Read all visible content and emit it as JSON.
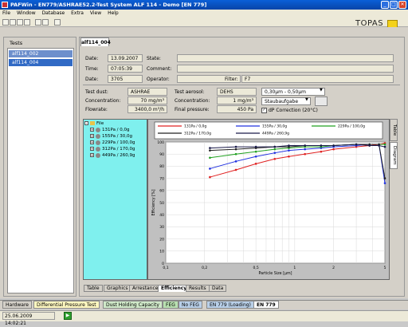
{
  "window": {
    "title": "PAFWin - EN779/ASHRAE52.2-Test System ALF 114 - Demo  [EN 779]",
    "controls": [
      "_",
      "□",
      "✕"
    ]
  },
  "menu": [
    "File",
    "Window",
    "Database",
    "Extra",
    "View",
    "Help"
  ],
  "logo": {
    "text": "TOPAS"
  },
  "tests": {
    "label": "Tests",
    "items": [
      "alf114_002",
      "alf114_004"
    ]
  },
  "detail": {
    "tab": "alf114_004",
    "date_label": "Date:",
    "date": "13.09.2007",
    "time_label": "Time:",
    "time": "07:05:39",
    "duration_label": "Date:",
    "duration": "3705",
    "state_label": "State:",
    "state": "",
    "comment_label": "Comment:",
    "comment": "",
    "operator_label": "Operator:",
    "operator": "",
    "filter_label": "Filter:",
    "filter": "F7",
    "test_dust_label": "Test dust:",
    "test_dust": "ASHRAE",
    "concentration_label": "Concentration:",
    "concentration": "70 mg/m³",
    "flowrate_label": "Flowrate:",
    "flowrate": "3400,0 m³/h",
    "test_aerosol_label": "Test aerosol:",
    "test_aerosol": "DEHS",
    "aerosol_conc_label": "Concentration:",
    "aerosol_conc": "1 mg/m³",
    "final_pressure_label": "Final pressure:",
    "final_pressure": "450 Pa",
    "range_select": "0,30µm - 0,50µm",
    "mode_select": "Staubaufgabe",
    "dp_correction": "dP Correction (20°C)"
  },
  "tree": {
    "root": "File",
    "items": [
      "131Pa / 0,0g",
      "155Pa / 30,0g",
      "229Pa / 100,0g",
      "312Pa / 170,0g",
      "449Pa / 260,9g"
    ]
  },
  "side_tabs": [
    "Table",
    "Diagram"
  ],
  "bottom_tabs": [
    "Table",
    "Graphics",
    "Arrestance",
    "Efficiency",
    "Results",
    "Data"
  ],
  "status_tabs": [
    "Hardware",
    "Differential Pressure Test",
    "Dust Holding Capacity",
    "FEG",
    "No FEG",
    "EN 779 (Loading)",
    "EN 779"
  ],
  "status": {
    "time": "25.06.2009 14:02:21"
  },
  "colors": {
    "accent": "#316ac5",
    "titlebar": "#0a5fd8",
    "tree_bg": "#7ff0ee"
  },
  "chart_data": {
    "type": "line",
    "xlabel": "Particle Size [µm]",
    "ylabel": "Efficiency [%]",
    "xscale": "log",
    "xlim": [
      0.1,
      5
    ],
    "ylim": [
      0,
      100
    ],
    "x_ticks": [
      "0,1",
      "0,2",
      "0,5",
      "1",
      "2",
      "5"
    ],
    "y_ticks": [
      0,
      10,
      20,
      30,
      40,
      50,
      60,
      70,
      80,
      90,
      100
    ],
    "x": [
      0.22,
      0.35,
      0.5,
      0.7,
      0.9,
      1.2,
      1.6,
      2.0,
      3.0,
      3.8,
      4.5,
      5.0
    ],
    "series": [
      {
        "name": "131Pa / 0,0g",
        "color": "#e02020",
        "values": [
          71,
          77,
          82,
          86,
          88,
          90,
          92,
          94,
          96,
          97,
          98,
          99
        ]
      },
      {
        "name": "155Pa / 30,0g",
        "color": "#2030e0",
        "values": [
          78,
          84,
          88,
          91,
          93,
          94,
          95,
          96,
          97,
          98,
          98,
          66
        ]
      },
      {
        "name": "229Pa / 100,0g",
        "color": "#20a020",
        "values": [
          87,
          90,
          92,
          94,
          95,
          96,
          96,
          97,
          98,
          98,
          98,
          98
        ]
      },
      {
        "name": "312Pa / 170,0g",
        "color": "#202020",
        "values": [
          93,
          94,
          95,
          96,
          96,
          97,
          97,
          97,
          98,
          98,
          98,
          70
        ]
      },
      {
        "name": "449Pa / 260,9g",
        "color": "#1a1a4a",
        "values": [
          95,
          96,
          96,
          96,
          97,
          97,
          97,
          97,
          98,
          97,
          97,
          96
        ]
      }
    ]
  }
}
